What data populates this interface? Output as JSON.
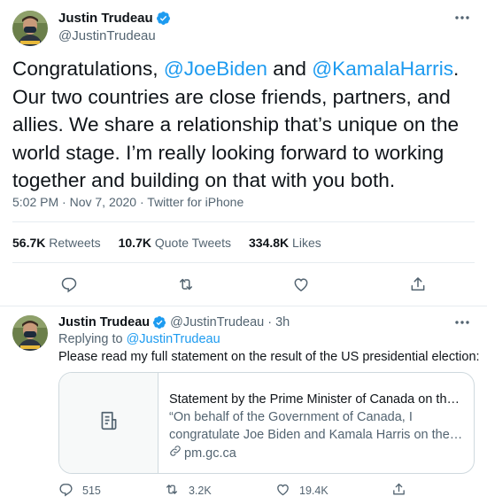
{
  "main_tweet": {
    "author_name": "Justin Trudeau",
    "author_handle": "@JustinTrudeau",
    "text_parts": {
      "p1": "Congratulations, ",
      "mention1": "@JoeBiden",
      "p2": " and ",
      "mention2": "@KamalaHarris",
      "p3": ". Our two countries are close friends, partners, and allies. We share a relationship that’s unique on the world stage. I’m really looking forward to working together and building on that with you both."
    },
    "time": "5:02 PM",
    "date": "Nov 7, 2020",
    "source": "Twitter for iPhone",
    "stats": {
      "retweets_count": "56.7K",
      "retweets_label": "Retweets",
      "quote_count": "10.7K",
      "quote_label": "Quote Tweets",
      "likes_count": "334.8K",
      "likes_label": "Likes"
    }
  },
  "reply_tweet": {
    "author_name": "Justin Trudeau",
    "author_handle": "@JustinTrudeau",
    "age": "3h",
    "replying_to_label": "Replying to",
    "replying_to_handle": "@JustinTrudeau",
    "text": "Please read my full statement on the result of the US presidential election:",
    "card": {
      "title": "Statement by the Prime Minister of Canada on the re...",
      "desc_line1": "“On behalf of the Government of Canada, I",
      "desc_line2": "congratulate Joe Biden and Kamala Harris on their ...",
      "domain": "pm.gc.ca"
    },
    "counts": {
      "replies": "515",
      "retweets": "3.2K",
      "likes": "19.4K"
    }
  },
  "colors": {
    "accent": "#1d9bf0",
    "secondary_text": "#536471",
    "border": "#cfd9de"
  }
}
